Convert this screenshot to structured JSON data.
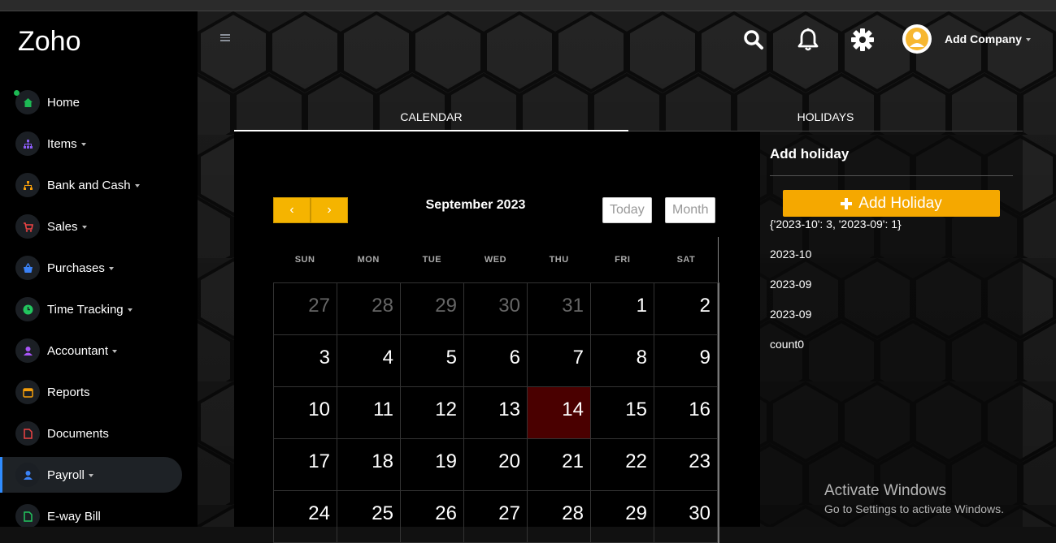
{
  "sidebar": {
    "brand": "Zoho",
    "items": [
      {
        "label": "Home",
        "icon": "home-icon",
        "color": "#1db954",
        "caret": false
      },
      {
        "label": "Items",
        "icon": "sitemap-icon",
        "color": "#8b5cf6",
        "caret": true
      },
      {
        "label": "Bank and Cash",
        "icon": "bank-icon",
        "color": "#f59e0b",
        "caret": true
      },
      {
        "label": "Sales",
        "icon": "cart-icon",
        "color": "#ef4444",
        "caret": true
      },
      {
        "label": "Purchases",
        "icon": "basket-icon",
        "color": "#3b82f6",
        "caret": true
      },
      {
        "label": "Time Tracking",
        "icon": "clock-icon",
        "color": "#22c55e",
        "caret": true
      },
      {
        "label": "Accountant",
        "icon": "person-icon",
        "color": "#a855f7",
        "caret": true
      },
      {
        "label": "Reports",
        "icon": "calendar-icon",
        "color": "#f59e0b",
        "caret": false
      },
      {
        "label": "Documents",
        "icon": "document-icon",
        "color": "#ef4444",
        "caret": false
      },
      {
        "label": "Payroll",
        "icon": "user-icon",
        "color": "#3b82f6",
        "caret": true,
        "active": true
      },
      {
        "label": "E-way Bill",
        "icon": "file-icon",
        "color": "#22c55e",
        "caret": false
      }
    ]
  },
  "header": {
    "company_label": "Add Company",
    "icons": [
      "search-icon",
      "bell-icon",
      "gear-icon",
      "avatar-icon",
      "menu-icon"
    ]
  },
  "tabs": [
    {
      "label": "CALENDAR",
      "active": true
    },
    {
      "label": "HOLIDAYS",
      "active": false
    }
  ],
  "calendar": {
    "month_title": "September 2023",
    "today_label": "Today",
    "month_label": "Month",
    "prev_symbol": "‹",
    "next_symbol": "›",
    "weekdays": [
      "SUN",
      "MON",
      "TUE",
      "WED",
      "THU",
      "FRI",
      "SAT"
    ],
    "weeks": [
      [
        {
          "d": "27",
          "o": true
        },
        {
          "d": "28",
          "o": true
        },
        {
          "d": "29",
          "o": true
        },
        {
          "d": "30",
          "o": true
        },
        {
          "d": "31",
          "o": true
        },
        {
          "d": "1"
        },
        {
          "d": "2"
        }
      ],
      [
        {
          "d": "3"
        },
        {
          "d": "4"
        },
        {
          "d": "5"
        },
        {
          "d": "6"
        },
        {
          "d": "7"
        },
        {
          "d": "8"
        },
        {
          "d": "9"
        }
      ],
      [
        {
          "d": "10"
        },
        {
          "d": "11"
        },
        {
          "d": "12"
        },
        {
          "d": "13"
        },
        {
          "d": "14",
          "today": true
        },
        {
          "d": "15"
        },
        {
          "d": "16"
        }
      ],
      [
        {
          "d": "17"
        },
        {
          "d": "18"
        },
        {
          "d": "19"
        },
        {
          "d": "20"
        },
        {
          "d": "21"
        },
        {
          "d": "22"
        },
        {
          "d": "23"
        }
      ],
      [
        {
          "d": "24"
        },
        {
          "d": "25"
        },
        {
          "d": "26"
        },
        {
          "d": "27"
        },
        {
          "d": "28"
        },
        {
          "d": "29"
        },
        {
          "d": "30"
        }
      ]
    ],
    "today_color": "#4a0000",
    "nav_color": "#f5b400"
  },
  "holidays": {
    "title": "Add holiday",
    "add_button": "Add Holiday",
    "lines": [
      "{'2023-10': 3, '2023-09': 1}",
      "2023-10",
      "2023-09",
      "2023-09",
      "count0"
    ],
    "button_color": "#f5a800"
  },
  "watermark": {
    "title": "Activate Windows",
    "subtitle": "Go to Settings to activate Windows."
  }
}
